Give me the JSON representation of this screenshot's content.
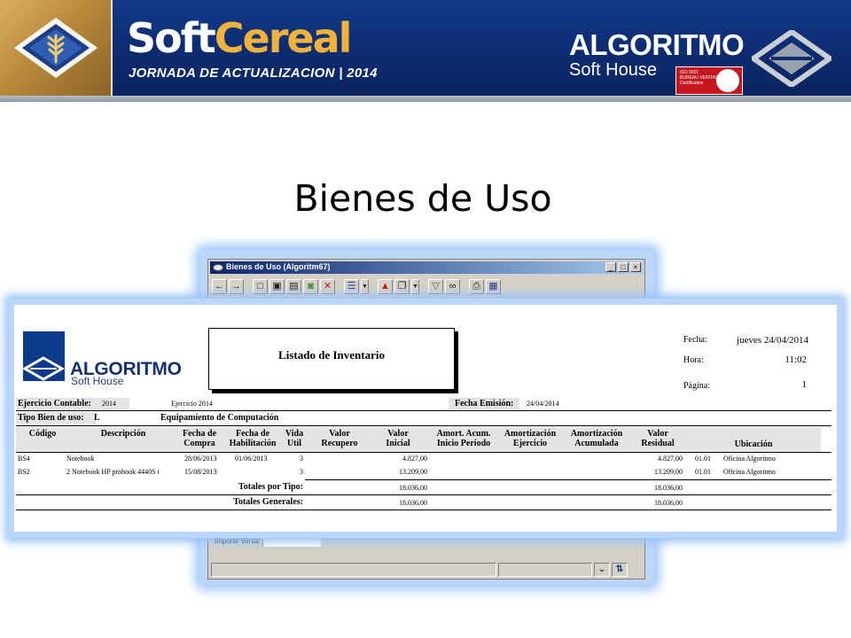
{
  "banner": {
    "title_soft": "Soft",
    "title_cereal": "Cereal",
    "subtitle": "JORNADA DE ACTUALIZACION | 2014",
    "partner_name": "ALGORITMO",
    "partner_tagline": "Soft House",
    "colors": {
      "background": "#0d2c70",
      "accent": "#f0b23a",
      "iso_badge": "#c4161c"
    }
  },
  "slide": {
    "title": "Bienes de Uso"
  },
  "app": {
    "window_title": "Bienes de Uso (Algoritm67)",
    "toolbar_icons": [
      "back-arrow-icon",
      "forward-arrow-icon",
      "new-document-icon",
      "save-icon",
      "save-disabled-icon",
      "export-icon",
      "delete-icon",
      "list-view-icon",
      "dropdown-icon",
      "alert-icon",
      "windows-icon",
      "dropdown-icon",
      "filter-icon",
      "binoculars-icon",
      "printer-icon",
      "calculator-icon"
    ],
    "venta_label": "Importe Venta:",
    "venta_value": ""
  },
  "report": {
    "logo_name": "ALGORITMO",
    "logo_tagline": "Soft House",
    "title": "Listado de Inventario",
    "fecha_label": "Fecha:",
    "fecha_value": "jueves 24/04/2014",
    "hora_label": "Hora:",
    "hora_value": "11:02",
    "pagina_label": "Página:",
    "pagina_value": "1",
    "ejercicio_label": "Ejercicio Contable:",
    "ejercicio_code": "2014",
    "ejercicio_desc": "Ejercicio 2014",
    "fecha_emision_label": "Fecha Emisión:",
    "fecha_emision_value": "24/04/2014",
    "tipo_label": "Tipo Bien de uso:",
    "tipo_code": "L",
    "tipo_desc": "Equipamiento de Computación",
    "columns": {
      "codigo": "Código",
      "descripcion": "Descripción",
      "fecha_compra_1": "Fecha de",
      "fecha_compra_2": "Compra",
      "fecha_hab_1": "Fecha de",
      "fecha_hab_2": "Habilitación",
      "vida_1": "Vida",
      "vida_2": "Util",
      "recupero_1": "Valor",
      "recupero_2": "Recupero",
      "inicial_1": "Valor",
      "inicial_2": "Inicial",
      "amort_acum_1": "Amort. Acum.",
      "amort_acum_2": "Inicio Período",
      "amort_ej_1": "Amortización",
      "amort_ej_2": "Ejercicio",
      "amort_acu_1": "Amortización",
      "amort_acu_2": "Acumulada",
      "residual_1": "Valor",
      "residual_2": "Residual",
      "ubicacion": "Ubicación"
    },
    "rows": [
      {
        "codigo": "BS4",
        "descripcion": "Notebook",
        "fecha_compra": "28/06/2013",
        "fecha_hab": "01/06/2013",
        "vida": "3",
        "valor_inicial": "4.827,00",
        "valor_residual": "4.827,00",
        "ubic_code": "01.01",
        "ubic_name": "Oficina Algoritmo"
      },
      {
        "codigo": "BS2",
        "descripcion": "2 Notebook HP probook 4440S i",
        "fecha_compra": "15/08/2013",
        "fecha_hab": "",
        "vida": "3",
        "valor_inicial": "13.209,00",
        "valor_residual": "13.209,00",
        "ubic_code": "01.01",
        "ubic_name": "Oficina Algoritmo"
      }
    ],
    "totales_tipo_label": "Totales por Tipo:",
    "totales_tipo_inicial": "18.036,00",
    "totales_tipo_residual": "18.036,00",
    "totales_gen_label": "Totales Generales:",
    "totales_gen_inicial": "18.036,00",
    "totales_gen_residual": "18.036,00"
  }
}
